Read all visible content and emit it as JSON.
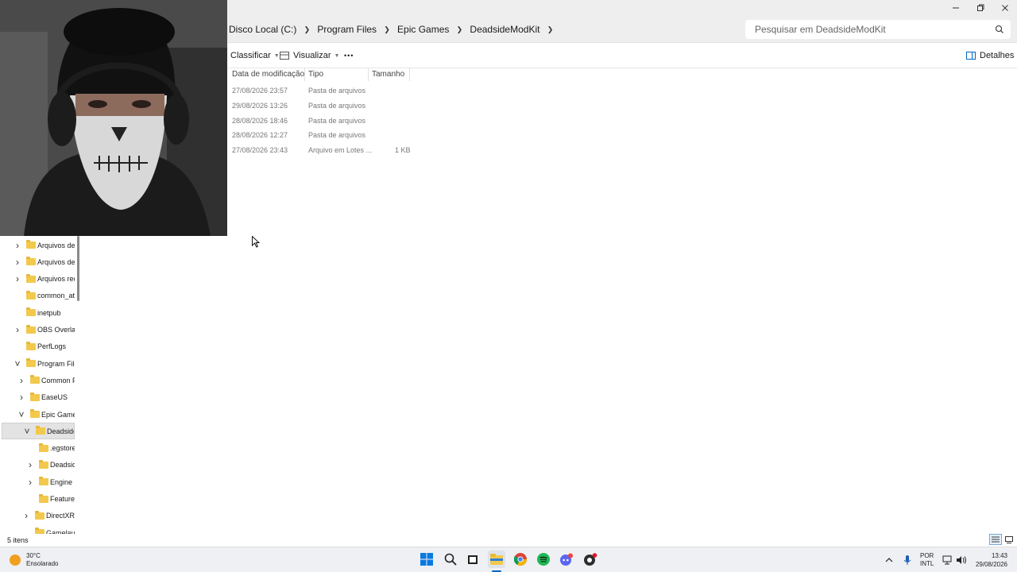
{
  "window": {
    "minimize_glyph": "—",
    "close_glyph": "✕"
  },
  "breadcrumb": [
    "Disco Local (C:)",
    "Program Files",
    "Epic Games",
    "DeadsideModKit"
  ],
  "search": {
    "placeholder": "Pesquisar em DeadsideModKit"
  },
  "toolbar": {
    "sort_label": "Classificar",
    "view_label": "Visualizar",
    "more_label": "•••",
    "details_label": "Detalhes"
  },
  "columns": {
    "modified": "Data de modificação",
    "type": "Tipo",
    "size": "Tamanho"
  },
  "files": [
    {
      "modified": "27/08/2026 23:57",
      "type": "Pasta de arquivos",
      "size": ""
    },
    {
      "modified": "29/08/2026 13:26",
      "type": "Pasta de arquivos",
      "size": ""
    },
    {
      "modified": "28/08/2026 18:46",
      "type": "Pasta de arquivos",
      "size": ""
    },
    {
      "modified": "28/08/2026 12:27",
      "type": "Pasta de arquivos",
      "size": ""
    },
    {
      "modified": "27/08/2026 23:43",
      "type": "Arquivo em Lotes ...",
      "size": "1 KB"
    }
  ],
  "tree": [
    {
      "label": "Arquivos de I",
      "expandable": true,
      "expanded": false,
      "level": 0,
      "selected": false
    },
    {
      "label": "Arquivos de I",
      "expandable": true,
      "expanded": false,
      "level": 0,
      "selected": false
    },
    {
      "label": "Arquivos reci",
      "expandable": true,
      "expanded": false,
      "level": 0,
      "selected": false
    },
    {
      "label": "common_att",
      "expandable": false,
      "expanded": false,
      "level": 0,
      "selected": false
    },
    {
      "label": "inetpub",
      "expandable": false,
      "expanded": false,
      "level": 0,
      "selected": false
    },
    {
      "label": "OBS Overlays",
      "expandable": true,
      "expanded": false,
      "level": 0,
      "selected": false
    },
    {
      "label": "PerfLogs",
      "expandable": false,
      "expanded": false,
      "level": 0,
      "selected": false
    },
    {
      "label": "Program File",
      "expandable": true,
      "expanded": true,
      "level": 0,
      "selected": false
    },
    {
      "label": "Common F",
      "expandable": true,
      "expanded": false,
      "level": 1,
      "selected": false
    },
    {
      "label": "EaseUS",
      "expandable": true,
      "expanded": false,
      "level": 1,
      "selected": false
    },
    {
      "label": "Epic Games",
      "expandable": true,
      "expanded": true,
      "level": 1,
      "selected": false
    },
    {
      "label": "DeadsideM",
      "expandable": true,
      "expanded": true,
      "level": 2,
      "selected": true
    },
    {
      "label": ".egstore",
      "expandable": false,
      "expanded": false,
      "level": 3,
      "selected": false
    },
    {
      "label": "Deadside",
      "expandable": true,
      "expanded": false,
      "level": 3,
      "selected": false
    },
    {
      "label": "Engine",
      "expandable": true,
      "expanded": false,
      "level": 3,
      "selected": false
    },
    {
      "label": "FeatureP",
      "expandable": false,
      "expanded": false,
      "level": 3,
      "selected": false
    },
    {
      "label": "DirectXRe",
      "expandable": true,
      "expanded": false,
      "level": 2,
      "selected": false
    },
    {
      "label": "Gamelaun",
      "expandable": false,
      "expanded": false,
      "level": 2,
      "selected": false
    }
  ],
  "status": {
    "item_count": "5 itens"
  },
  "weather": {
    "temp": "30°C",
    "condition": "Ensolarado"
  },
  "taskbar": {
    "apps": [
      "windows-start-icon",
      "search-icon",
      "task-view-icon",
      "file-explorer-icon",
      "chrome-icon",
      "spotify-icon",
      "discord-icon",
      "obs-icon"
    ]
  },
  "tray": {
    "lang": "POR",
    "layout": "INTL",
    "time": "13:43",
    "date": "29/08/2026"
  },
  "colors": {
    "folder": "#f2c94c",
    "accent": "#0067c0",
    "taskbar": "#eef0f3"
  }
}
